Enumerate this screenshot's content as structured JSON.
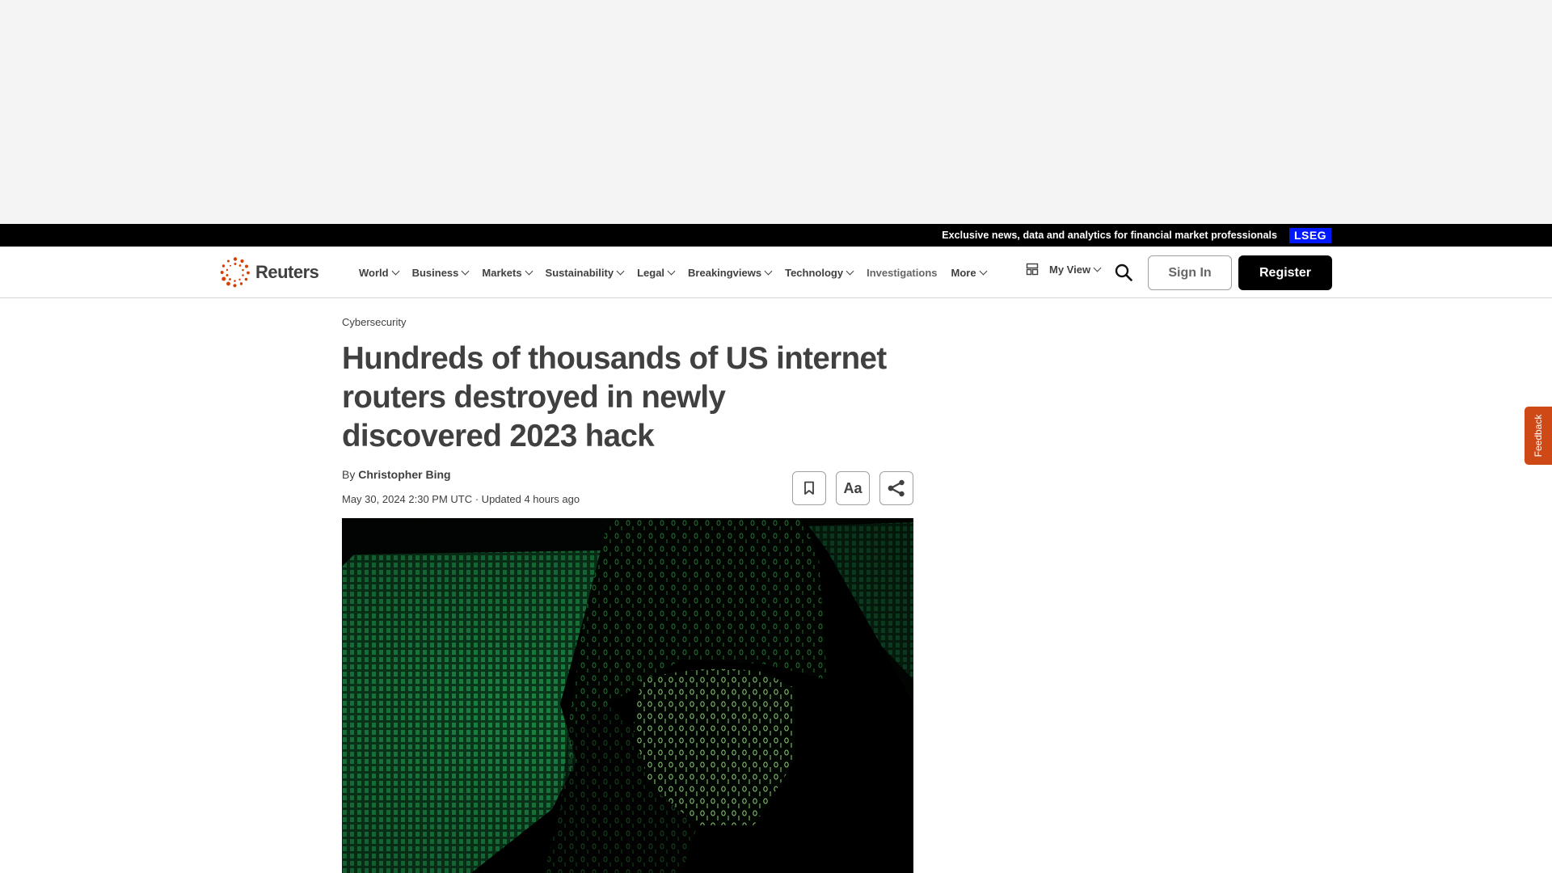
{
  "promo": {
    "text": "Exclusive news, data and analytics for financial market professionals",
    "badge": "LSEG",
    "badge_color": "#0018ff"
  },
  "brand": {
    "name": "Reuters",
    "logo_icon": "reuters-dot-circle-logo",
    "accent": "#d64000"
  },
  "nav": {
    "items": [
      {
        "label": "World",
        "has_dropdown": true
      },
      {
        "label": "Business",
        "has_dropdown": true
      },
      {
        "label": "Markets",
        "has_dropdown": true
      },
      {
        "label": "Sustainability",
        "has_dropdown": true
      },
      {
        "label": "Legal",
        "has_dropdown": true
      },
      {
        "label": "Breakingviews",
        "has_dropdown": true
      },
      {
        "label": "Technology",
        "has_dropdown": true
      },
      {
        "label": "Investigations",
        "has_dropdown": false
      },
      {
        "label": "More",
        "has_dropdown": true
      }
    ],
    "my_view": "My View",
    "sign_in": "Sign In",
    "register": "Register"
  },
  "feedback": {
    "label": "Feedback",
    "color": "#cf4917"
  },
  "article": {
    "kicker": "Cybersecurity",
    "headline": "Hundreds of thousands of US internet routers destroyed in newly discovered 2023 hack",
    "byline_prefix": "By",
    "author": "Christopher Bing",
    "dateline": "May 30, 2024 2:30 PM UTC · Updated 4 hours ago",
    "actions": {
      "bookmark_icon": "bookmark-icon",
      "text_size_label": "Aa",
      "share_icon": "share-icon"
    },
    "hero_image": {
      "description": "Hooded figure with binary code projected in green onto a dark background"
    }
  }
}
